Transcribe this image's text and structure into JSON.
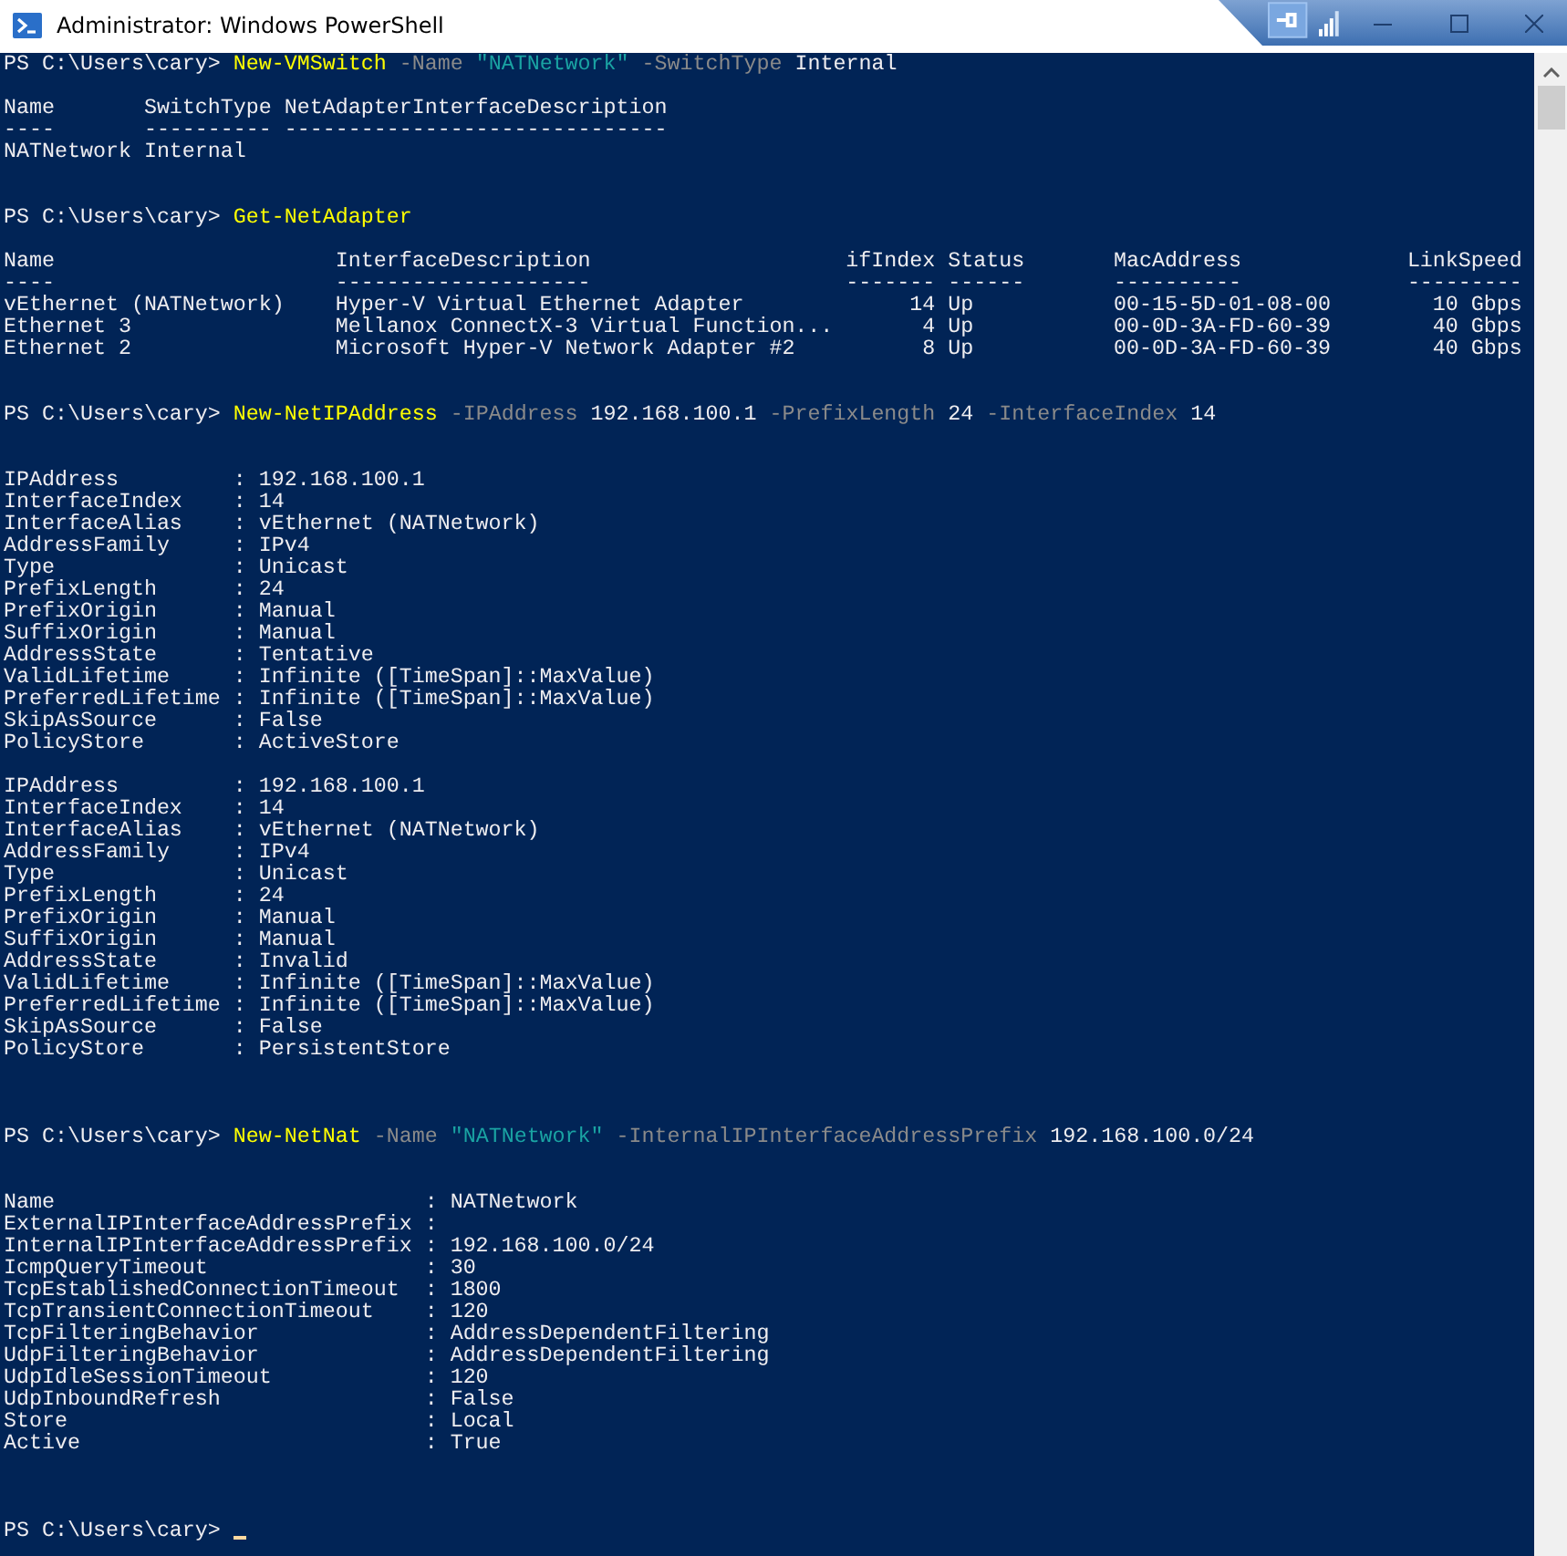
{
  "window": {
    "title": "Administrator: Windows PowerShell"
  },
  "console": {
    "cursor": true,
    "lines": [
      {
        "kind": "command",
        "segments": [
          {
            "kind": "prompt",
            "text": "PS C:\\Users\\cary> "
          },
          {
            "kind": "cmdlet",
            "text": "New-VMSwitch"
          },
          {
            "kind": "parameter",
            "text": " -Name "
          },
          {
            "kind": "string",
            "text": "\"NATNetwork\""
          },
          {
            "kind": "parameter",
            "text": " -SwitchType"
          },
          {
            "kind": "argument",
            "text": " Internal"
          }
        ]
      },
      {
        "kind": "blank"
      },
      {
        "kind": "output",
        "text": "Name       SwitchType NetAdapterInterfaceDescription"
      },
      {
        "kind": "output",
        "text": "----       ---------- ------------------------------"
      },
      {
        "kind": "output",
        "text": "NATNetwork Internal"
      },
      {
        "kind": "blank"
      },
      {
        "kind": "blank"
      },
      {
        "kind": "command",
        "segments": [
          {
            "kind": "prompt",
            "text": "PS C:\\Users\\cary> "
          },
          {
            "kind": "cmdlet",
            "text": "Get-NetAdapter"
          }
        ]
      },
      {
        "kind": "blank"
      },
      {
        "kind": "output",
        "text": "Name                      InterfaceDescription                    ifIndex Status       MacAddress             LinkSpeed"
      },
      {
        "kind": "output",
        "text": "----                      --------------------                    ------- ------       ----------             ---------"
      },
      {
        "kind": "output",
        "text": "vEthernet (NATNetwork)    Hyper-V Virtual Ethernet Adapter             14 Up           00-15-5D-01-08-00        10 Gbps"
      },
      {
        "kind": "output",
        "text": "Ethernet 3                Mellanox ConnectX-3 Virtual Function...       4 Up           00-0D-3A-FD-60-39        40 Gbps"
      },
      {
        "kind": "output",
        "text": "Ethernet 2                Microsoft Hyper-V Network Adapter #2          8 Up           00-0D-3A-FD-60-39        40 Gbps"
      },
      {
        "kind": "blank"
      },
      {
        "kind": "blank"
      },
      {
        "kind": "command",
        "segments": [
          {
            "kind": "prompt",
            "text": "PS C:\\Users\\cary> "
          },
          {
            "kind": "cmdlet",
            "text": "New-NetIPAddress"
          },
          {
            "kind": "parameter",
            "text": " -IPAddress"
          },
          {
            "kind": "argument",
            "text": " 192.168.100.1"
          },
          {
            "kind": "parameter",
            "text": " -PrefixLength"
          },
          {
            "kind": "argument",
            "text": " 24"
          },
          {
            "kind": "parameter",
            "text": " -InterfaceIndex"
          },
          {
            "kind": "argument",
            "text": " 14"
          }
        ]
      },
      {
        "kind": "blank"
      },
      {
        "kind": "blank"
      },
      {
        "kind": "output",
        "text": "IPAddress         : 192.168.100.1"
      },
      {
        "kind": "output",
        "text": "InterfaceIndex    : 14"
      },
      {
        "kind": "output",
        "text": "InterfaceAlias    : vEthernet (NATNetwork)"
      },
      {
        "kind": "output",
        "text": "AddressFamily     : IPv4"
      },
      {
        "kind": "output",
        "text": "Type              : Unicast"
      },
      {
        "kind": "output",
        "text": "PrefixLength      : 24"
      },
      {
        "kind": "output",
        "text": "PrefixOrigin      : Manual"
      },
      {
        "kind": "output",
        "text": "SuffixOrigin      : Manual"
      },
      {
        "kind": "output",
        "text": "AddressState      : Tentative"
      },
      {
        "kind": "output",
        "text": "ValidLifetime     : Infinite ([TimeSpan]::MaxValue)"
      },
      {
        "kind": "output",
        "text": "PreferredLifetime : Infinite ([TimeSpan]::MaxValue)"
      },
      {
        "kind": "output",
        "text": "SkipAsSource      : False"
      },
      {
        "kind": "output",
        "text": "PolicyStore       : ActiveStore"
      },
      {
        "kind": "blank"
      },
      {
        "kind": "output",
        "text": "IPAddress         : 192.168.100.1"
      },
      {
        "kind": "output",
        "text": "InterfaceIndex    : 14"
      },
      {
        "kind": "output",
        "text": "InterfaceAlias    : vEthernet (NATNetwork)"
      },
      {
        "kind": "output",
        "text": "AddressFamily     : IPv4"
      },
      {
        "kind": "output",
        "text": "Type              : Unicast"
      },
      {
        "kind": "output",
        "text": "PrefixLength      : 24"
      },
      {
        "kind": "output",
        "text": "PrefixOrigin      : Manual"
      },
      {
        "kind": "output",
        "text": "SuffixOrigin      : Manual"
      },
      {
        "kind": "output",
        "text": "AddressState      : Invalid"
      },
      {
        "kind": "output",
        "text": "ValidLifetime     : Infinite ([TimeSpan]::MaxValue)"
      },
      {
        "kind": "output",
        "text": "PreferredLifetime : Infinite ([TimeSpan]::MaxValue)"
      },
      {
        "kind": "output",
        "text": "SkipAsSource      : False"
      },
      {
        "kind": "output",
        "text": "PolicyStore       : PersistentStore"
      },
      {
        "kind": "blank"
      },
      {
        "kind": "blank"
      },
      {
        "kind": "blank"
      },
      {
        "kind": "command",
        "segments": [
          {
            "kind": "prompt",
            "text": "PS C:\\Users\\cary> "
          },
          {
            "kind": "cmdlet",
            "text": "New-NetNat"
          },
          {
            "kind": "parameter",
            "text": " -Name "
          },
          {
            "kind": "string",
            "text": "\"NATNetwork\""
          },
          {
            "kind": "parameter",
            "text": " -InternalIPInterfaceAddressPrefix"
          },
          {
            "kind": "argument",
            "text": " 192.168.100.0/24"
          }
        ]
      },
      {
        "kind": "blank"
      },
      {
        "kind": "blank"
      },
      {
        "kind": "output",
        "text": "Name                             : NATNetwork"
      },
      {
        "kind": "output",
        "text": "ExternalIPInterfaceAddressPrefix :"
      },
      {
        "kind": "output",
        "text": "InternalIPInterfaceAddressPrefix : 192.168.100.0/24"
      },
      {
        "kind": "output",
        "text": "IcmpQueryTimeout                 : 30"
      },
      {
        "kind": "output",
        "text": "TcpEstablishedConnectionTimeout  : 1800"
      },
      {
        "kind": "output",
        "text": "TcpTransientConnectionTimeout    : 120"
      },
      {
        "kind": "output",
        "text": "TcpFilteringBehavior             : AddressDependentFiltering"
      },
      {
        "kind": "output",
        "text": "UdpFilteringBehavior             : AddressDependentFiltering"
      },
      {
        "kind": "output",
        "text": "UdpIdleSessionTimeout            : 120"
      },
      {
        "kind": "output",
        "text": "UdpInboundRefresh                : False"
      },
      {
        "kind": "output",
        "text": "Store                            : Local"
      },
      {
        "kind": "output",
        "text": "Active                           : True"
      },
      {
        "kind": "blank"
      },
      {
        "kind": "blank"
      },
      {
        "kind": "blank"
      },
      {
        "kind": "command",
        "segments": [
          {
            "kind": "prompt",
            "text": "PS C:\\Users\\cary> "
          }
        ]
      }
    ]
  }
}
